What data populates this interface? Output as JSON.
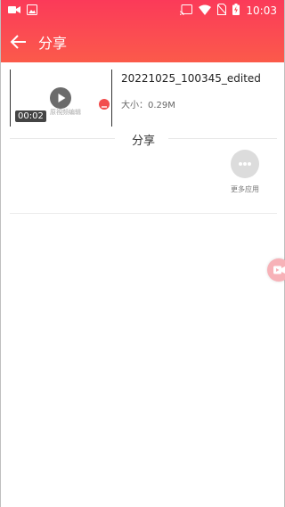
{
  "status_bar": {
    "time": "10:03"
  },
  "app_bar": {
    "title": "分享"
  },
  "video": {
    "name": "20221025_100345_edited",
    "size_label": "大小：0.29M",
    "duration": "00:02",
    "thumbnail_watermark": "原視频编辑"
  },
  "share_section": {
    "label": "分享",
    "more_apps_label": "更多应用"
  },
  "colors": {
    "header_gradient_top": "#fb3a59",
    "header_gradient_bottom": "#fb5a4a",
    "accent_red": "#f24d4d",
    "floating_button": "#f7b2b8"
  },
  "icons": {
    "status_left": [
      "video-camera-icon",
      "image-icon"
    ],
    "status_right": [
      "cast-icon",
      "wifi-icon",
      "no-sim-icon",
      "battery-charging-icon"
    ],
    "back": "arrow-left-icon",
    "play": "play-icon",
    "remove": "minus-icon",
    "more": "more-horizontal-icon",
    "floating": "video-record-icon"
  }
}
